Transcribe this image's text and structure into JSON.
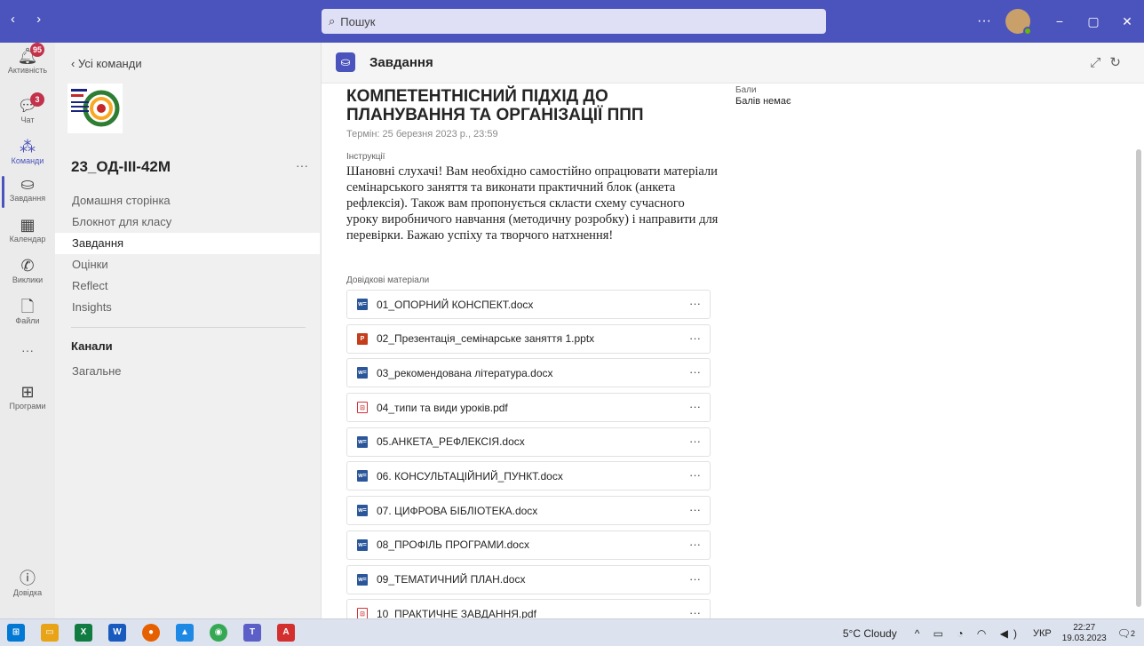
{
  "titlebar": {
    "nav": "‹ ›",
    "search_placeholder": "Пошук",
    "more": "···",
    "window_min": "−",
    "window_max": "▢",
    "window_close": "✕"
  },
  "rail": {
    "items": [
      {
        "label": "Активність",
        "icon": "bell-icon",
        "badge": "95"
      },
      {
        "label": "Чат",
        "icon": "chat-icon",
        "badge": "3"
      },
      {
        "label": "Команди",
        "icon": "teams-icon",
        "badge": ""
      },
      {
        "label": "Завдання",
        "icon": "assignments-icon",
        "badge": ""
      },
      {
        "label": "Календар",
        "icon": "calendar-icon",
        "badge": ""
      },
      {
        "label": "Виклики",
        "icon": "phone-icon",
        "badge": ""
      },
      {
        "label": "Файли",
        "icon": "file-icon",
        "badge": ""
      },
      {
        "label": "···",
        "icon": "more-icon",
        "badge": ""
      },
      {
        "label": "Програми",
        "icon": "apps-icon",
        "badge": ""
      },
      {
        "label": "Довідка",
        "icon": "help-icon",
        "badge": ""
      }
    ]
  },
  "teampanel": {
    "back": "‹  Усі команди",
    "team_name": "23_ОД-ІІІ-42М",
    "more": "···",
    "nav": [
      "Домашня сторінка",
      "Блокнот для класу",
      "Завдання",
      "Оцінки",
      "Reflect",
      "Insights"
    ],
    "channels_title": "Канали",
    "channels": [
      "Загальне"
    ]
  },
  "main": {
    "header_title": "Завдання",
    "task_title": "КОМПЕТЕНТНІСНИЙ ПІДХІД ДО ПЛАНУВАННЯ ТА ОРГАНІЗАЦІЇ ППП",
    "due": "Термін: 25 березня 2023 р., 23:59",
    "points_label": "Бали",
    "points_value": "Балів немає",
    "instructions_label": "Інструкції",
    "instructions": "Шановні слухачі! Вам необхідно самостійно опрацювати матеріали семінарського заняття та виконати практичний блок (анкета рефлексія). Також вам  пропонується скласти схему сучасного уроку виробничого навчання (методичну розробку) і направити для перевірки. Бажаю успіху та творчого натхнення!",
    "ref_label": "Довідкові матеріали",
    "files": [
      {
        "name": "01_ОПОРНИЙ КОНСПЕКТ.docx",
        "type": "word"
      },
      {
        "name": "02_Презентація_семінарське заняття 1.pptx",
        "type": "ppt"
      },
      {
        "name": "03_рекомендована література.docx",
        "type": "word"
      },
      {
        "name": "04_типи та види уроків.pdf",
        "type": "pdf"
      },
      {
        "name": "05.АНКЕТА_РЕФЛЕКСІЯ.docx",
        "type": "word"
      },
      {
        "name": "06. КОНСУЛЬТАЦІЙНИЙ_ПУНКТ.docx",
        "type": "word"
      },
      {
        "name": "07. ЦИФРОВА БІБЛІОТЕКА.docx",
        "type": "word"
      },
      {
        "name": "08_ПРОФІЛЬ ПРОГРАМИ.docx",
        "type": "word"
      },
      {
        "name": "09_ТЕМАТИЧНИЙ ПЛАН.docx",
        "type": "word"
      },
      {
        "name": "10_ПРАКТИЧНЕ ЗАВДАННЯ.pdf",
        "type": "pdf"
      }
    ]
  },
  "taskbar": {
    "weather": "5°C  Cloudy",
    "lang": "УКР",
    "time": "22:27",
    "date": "19.03.2023",
    "notif_count": "2"
  }
}
